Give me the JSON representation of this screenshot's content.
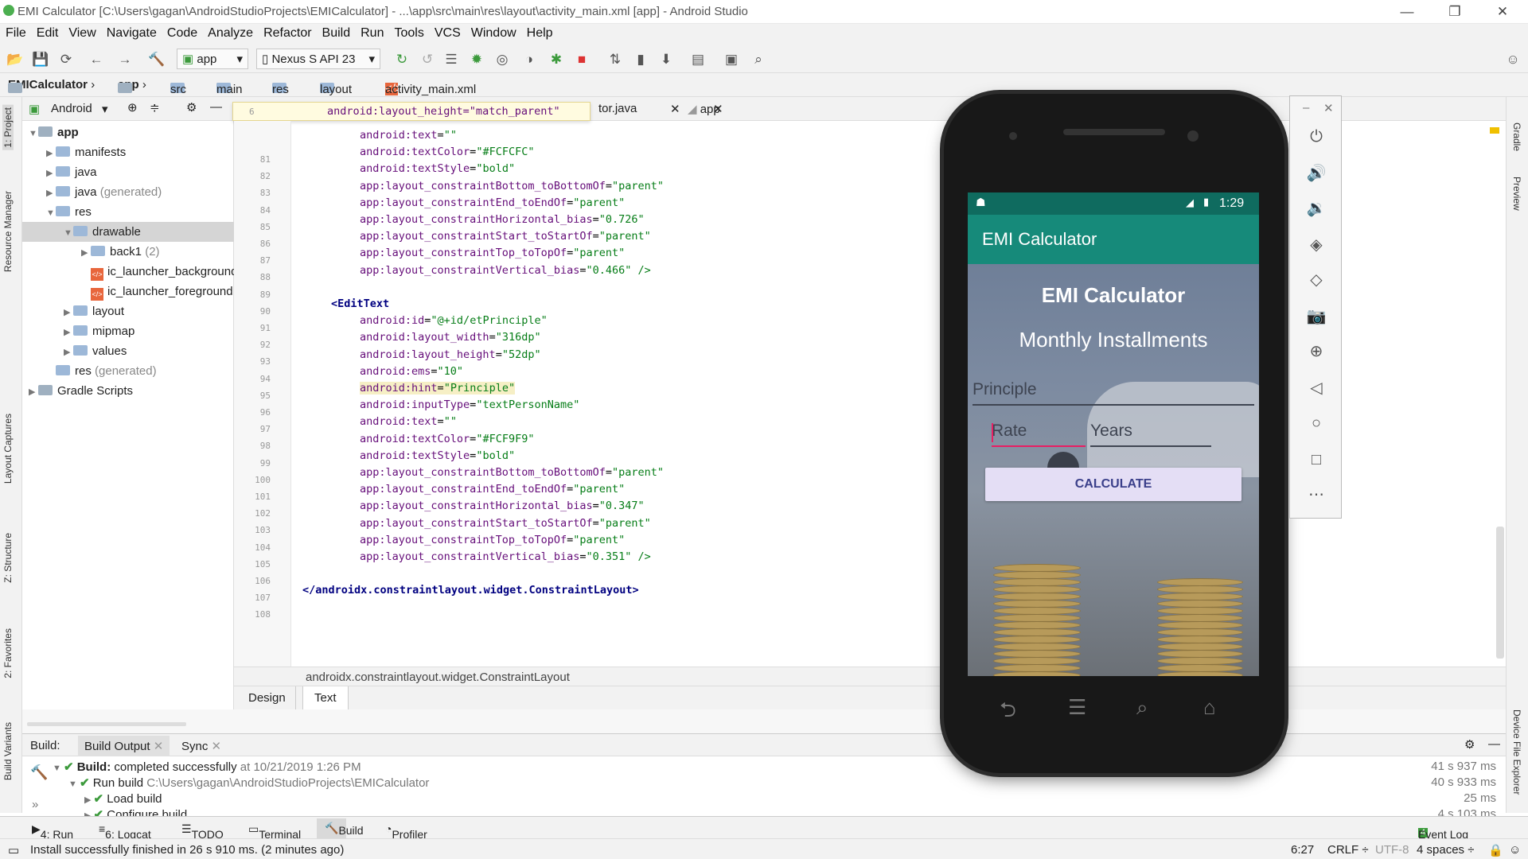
{
  "window": {
    "title": "EMI Calculator [C:\\Users\\gagan\\AndroidStudioProjects\\EMICalculator] - ...\\app\\src\\main\\res\\layout\\activity_main.xml [app] - Android Studio"
  },
  "menu": [
    "File",
    "Edit",
    "View",
    "Navigate",
    "Code",
    "Analyze",
    "Refactor",
    "Build",
    "Run",
    "Tools",
    "VCS",
    "Window",
    "Help"
  ],
  "toolbar": {
    "config": "app",
    "device": "Nexus S API 23"
  },
  "breadcrumb": [
    "EMICalculator",
    "app",
    "src",
    "main",
    "res",
    "layout",
    "activity_main.xml"
  ],
  "left_tabs": [
    "1: Project",
    "Resource Manager",
    "Layout Captures",
    "Z: Structure",
    "2: Favorites",
    "Build Variants"
  ],
  "right_tabs": [
    "Gradle",
    "Preview",
    "Device File Explorer"
  ],
  "project": {
    "view": "Android",
    "tree": [
      {
        "label": "app",
        "indent": 0,
        "arrow": "▼",
        "bold": true
      },
      {
        "label": "manifests",
        "indent": 1,
        "arrow": "▶"
      },
      {
        "label": "java",
        "indent": 1,
        "arrow": "▶"
      },
      {
        "label": "java",
        "suffix": "(generated)",
        "indent": 1,
        "arrow": "▶"
      },
      {
        "label": "res",
        "indent": 1,
        "arrow": "▼"
      },
      {
        "label": "drawable",
        "indent": 2,
        "arrow": "▼",
        "selected": true
      },
      {
        "label": "back1",
        "suffix": "(2)",
        "indent": 3,
        "arrow": "▶"
      },
      {
        "label": "ic_launcher_background",
        "indent": 3,
        "arrow": "",
        "xml": true
      },
      {
        "label": "ic_launcher_foreground",
        "indent": 3,
        "arrow": "",
        "xml": true
      },
      {
        "label": "layout",
        "indent": 2,
        "arrow": "▶"
      },
      {
        "label": "mipmap",
        "indent": 2,
        "arrow": "▶"
      },
      {
        "label": "values",
        "indent": 2,
        "arrow": "▶"
      },
      {
        "label": "res",
        "suffix": "(generated)",
        "indent": 1,
        "arrow": ""
      },
      {
        "label": "Gradle Scripts",
        "indent": 0,
        "arrow": "▶"
      }
    ]
  },
  "editor": {
    "tabs": [
      "tor.java",
      "app"
    ],
    "popup_line": {
      "num": "6",
      "text": "android:layout_height=\"match_parent\""
    },
    "lines": [
      {
        "n": "81",
        "a": "android:text",
        "v": "\"\""
      },
      {
        "n": "82",
        "a": "android:textColor",
        "v": "\"#FCFCFC\""
      },
      {
        "n": "83",
        "a": "android:textStyle",
        "v": "\"bold\""
      },
      {
        "n": "84",
        "a": "app:layout_constraintBottom_toBottomOf",
        "v": "\"parent\""
      },
      {
        "n": "85",
        "a": "app:layout_constraintEnd_toEndOf",
        "v": "\"parent\""
      },
      {
        "n": "86",
        "a": "app:layout_constraintHorizontal_bias",
        "v": "\"0.726\""
      },
      {
        "n": "87",
        "a": "app:layout_constraintStart_toStartOf",
        "v": "\"parent\""
      },
      {
        "n": "88",
        "a": "app:layout_constraintTop_toTopOf",
        "v": "\"parent\""
      },
      {
        "n": "89",
        "a": "app:layout_constraintVertical_bias",
        "v": "\"0.466\" />"
      },
      {
        "n": "90",
        "a": "",
        "v": ""
      },
      {
        "n": "91",
        "tag": "<EditText"
      },
      {
        "n": "92",
        "a": "android:id",
        "v": "\"@+id/etPrinciple\""
      },
      {
        "n": "93",
        "a": "android:layout_width",
        "v": "\"316dp\""
      },
      {
        "n": "94",
        "a": "android:layout_height",
        "v": "\"52dp\""
      },
      {
        "n": "95",
        "a": "android:ems",
        "v": "\"10\""
      },
      {
        "n": "96",
        "a": "android:hint",
        "v": "\"Principle\"",
        "hl": true
      },
      {
        "n": "97",
        "a": "android:inputType",
        "v": "\"textPersonName\""
      },
      {
        "n": "98",
        "a": "android:text",
        "v": "\"\""
      },
      {
        "n": "99",
        "a": "android:textColor",
        "v": "\"#FCF9F9\""
      },
      {
        "n": "100",
        "a": "android:textStyle",
        "v": "\"bold\""
      },
      {
        "n": "101",
        "a": "app:layout_constraintBottom_toBottomOf",
        "v": "\"parent\""
      },
      {
        "n": "102",
        "a": "app:layout_constraintEnd_toEndOf",
        "v": "\"parent\""
      },
      {
        "n": "103",
        "a": "app:layout_constraintHorizontal_bias",
        "v": "\"0.347\""
      },
      {
        "n": "104",
        "a": "app:layout_constraintStart_toStartOf",
        "v": "\"parent\""
      },
      {
        "n": "105",
        "a": "app:layout_constraintTop_toTopOf",
        "v": "\"parent\""
      },
      {
        "n": "106",
        "a": "app:layout_constraintVertical_bias",
        "v": "\"0.351\" />"
      },
      {
        "n": "107",
        "a": "",
        "v": ""
      },
      {
        "n": "108",
        "tag": "</androidx.constraintlayout.widget.ConstraintLayout>"
      }
    ],
    "footer": "androidx.constraintlayout.widget.ConstraintLayout",
    "design_tab": "Design",
    "text_tab": "Text"
  },
  "emulator": {
    "time": "1:29",
    "app_title": "EMI Calculator",
    "heading": "EMI Calculator",
    "subheading": "Monthly Installments",
    "principle_hint": "Principle",
    "rate_hint": "Rate",
    "years_hint": "Years",
    "button": "CALCULATE"
  },
  "build": {
    "label": "Build:",
    "tabs": [
      "Build Output",
      "Sync"
    ],
    "rows": [
      {
        "bold": "Build:",
        "text": "completed successfully",
        "extra": "at 10/21/2019 1:26 PM",
        "time": "41 s 937 ms"
      },
      {
        "bold": "",
        "text": "Run build",
        "extra": "C:\\Users\\gagan\\AndroidStudioProjects\\EMICalculator",
        "time": "40 s 933 ms"
      },
      {
        "bold": "",
        "text": "Load build",
        "extra": "",
        "time": "25 ms"
      },
      {
        "bold": "",
        "text": "Configure build",
        "extra": "",
        "time": "4 s 103 ms"
      }
    ]
  },
  "bottom_tabs": [
    "4: Run",
    "6: Logcat",
    "TODO",
    "Terminal",
    "Build",
    "Profiler"
  ],
  "event_log": "Event Log",
  "status": {
    "message": "Install successfully finished in 26 s 910 ms. (2 minutes ago)",
    "position": "6:27",
    "line_sep": "CRLF ÷",
    "encoding": "UTF-8",
    "indent": "4 spaces ÷"
  },
  "colors": {
    "accent": "#168a7a",
    "button": "#e4def5",
    "button_text": "#3a3f8a"
  }
}
